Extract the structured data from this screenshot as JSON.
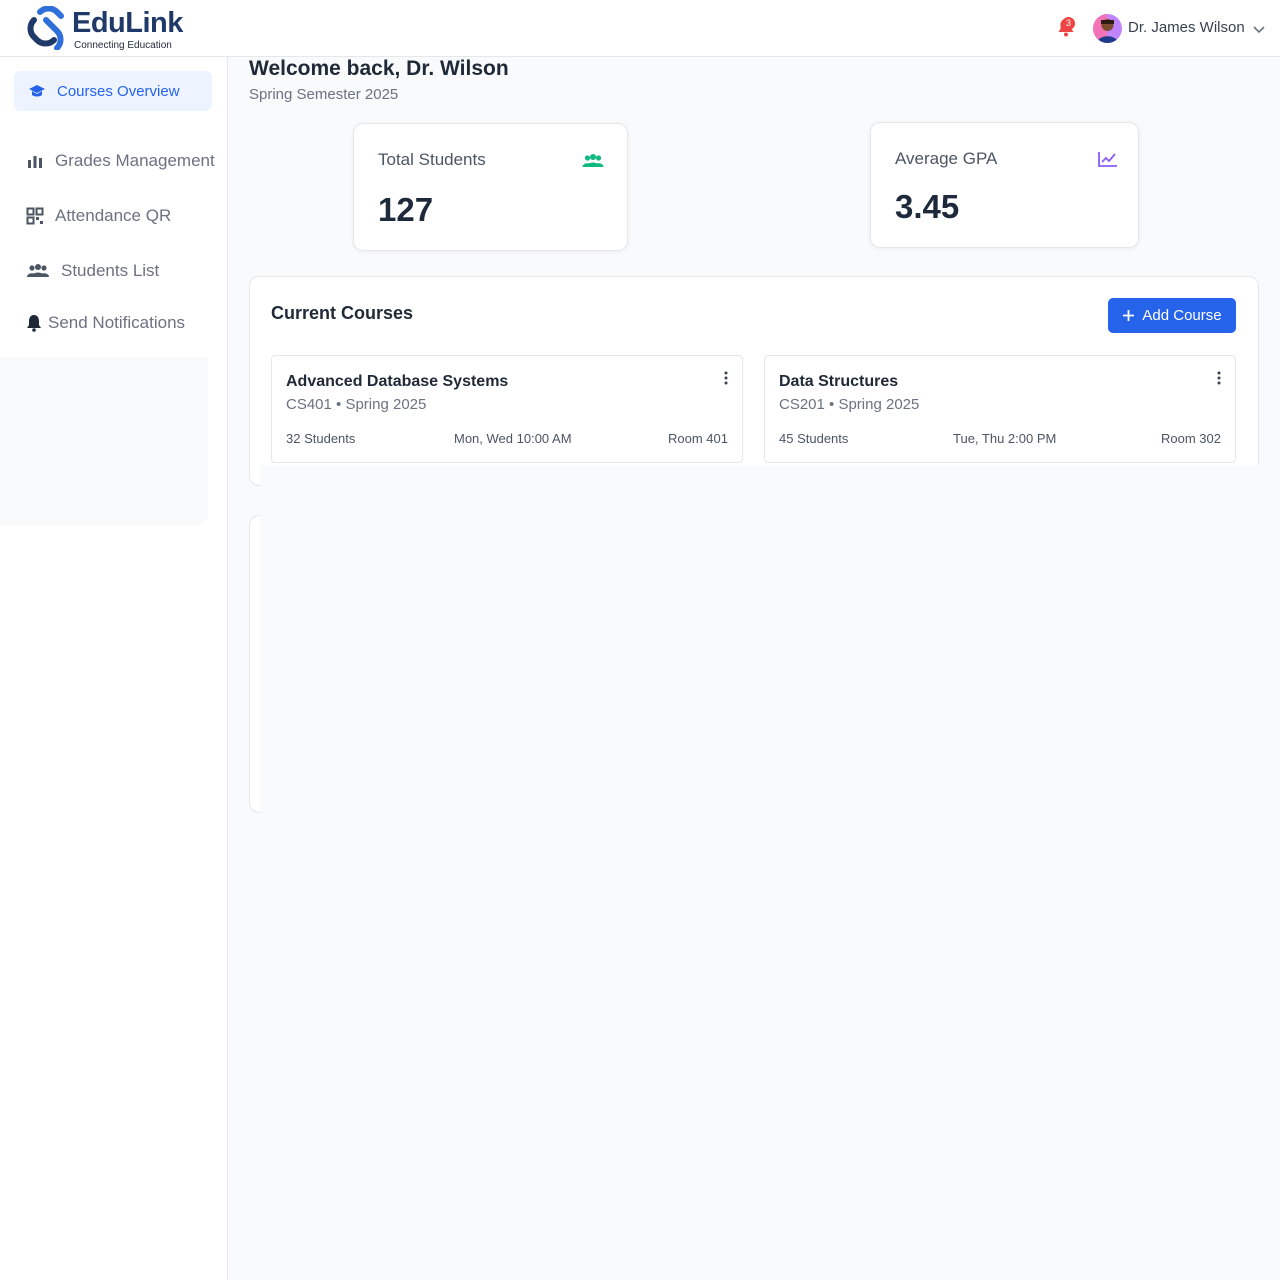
{
  "header": {
    "logo_text": "EduLink",
    "logo_tagline": "Connecting Education",
    "notification_count": "3",
    "user_name": "Dr. James Wilson"
  },
  "sidebar": {
    "items": [
      {
        "label": "Courses Overview",
        "icon": "graduation-cap-icon",
        "active": true
      },
      {
        "label": "Grades Management",
        "icon": "bar-chart-icon"
      },
      {
        "label": "Attendance QR",
        "icon": "qr-code-icon"
      },
      {
        "label": "Students List",
        "icon": "users-icon"
      },
      {
        "label": "Send Notifications",
        "icon": "bell-icon"
      }
    ]
  },
  "main": {
    "welcome": "Welcome back, Dr. Wilson",
    "semester": "Spring Semester 2025",
    "stats": [
      {
        "label": "Total Students",
        "value": "127",
        "icon": "users-icon",
        "color": "#10b981"
      },
      {
        "label": "Average GPA",
        "value": "3.45",
        "icon": "line-chart-icon",
        "color": "#8b5cf6"
      }
    ],
    "courses_title": "Current Courses",
    "add_course_label": "Add Course",
    "courses": [
      {
        "name": "Advanced Database Systems",
        "meta": "CS401 • Spring 2025",
        "students": "32 Students",
        "schedule": "Mon, Wed 10:00 AM",
        "room": "Room 401"
      },
      {
        "name": "Data Structures",
        "meta": "CS201 • Spring 2025",
        "students": "45 Students",
        "schedule": "Tue, Thu 2:00 PM",
        "room": "Room 302"
      }
    ]
  },
  "colors": {
    "primary": "#2563eb",
    "brand": "#1f3a68",
    "badge": "#ef4444"
  }
}
